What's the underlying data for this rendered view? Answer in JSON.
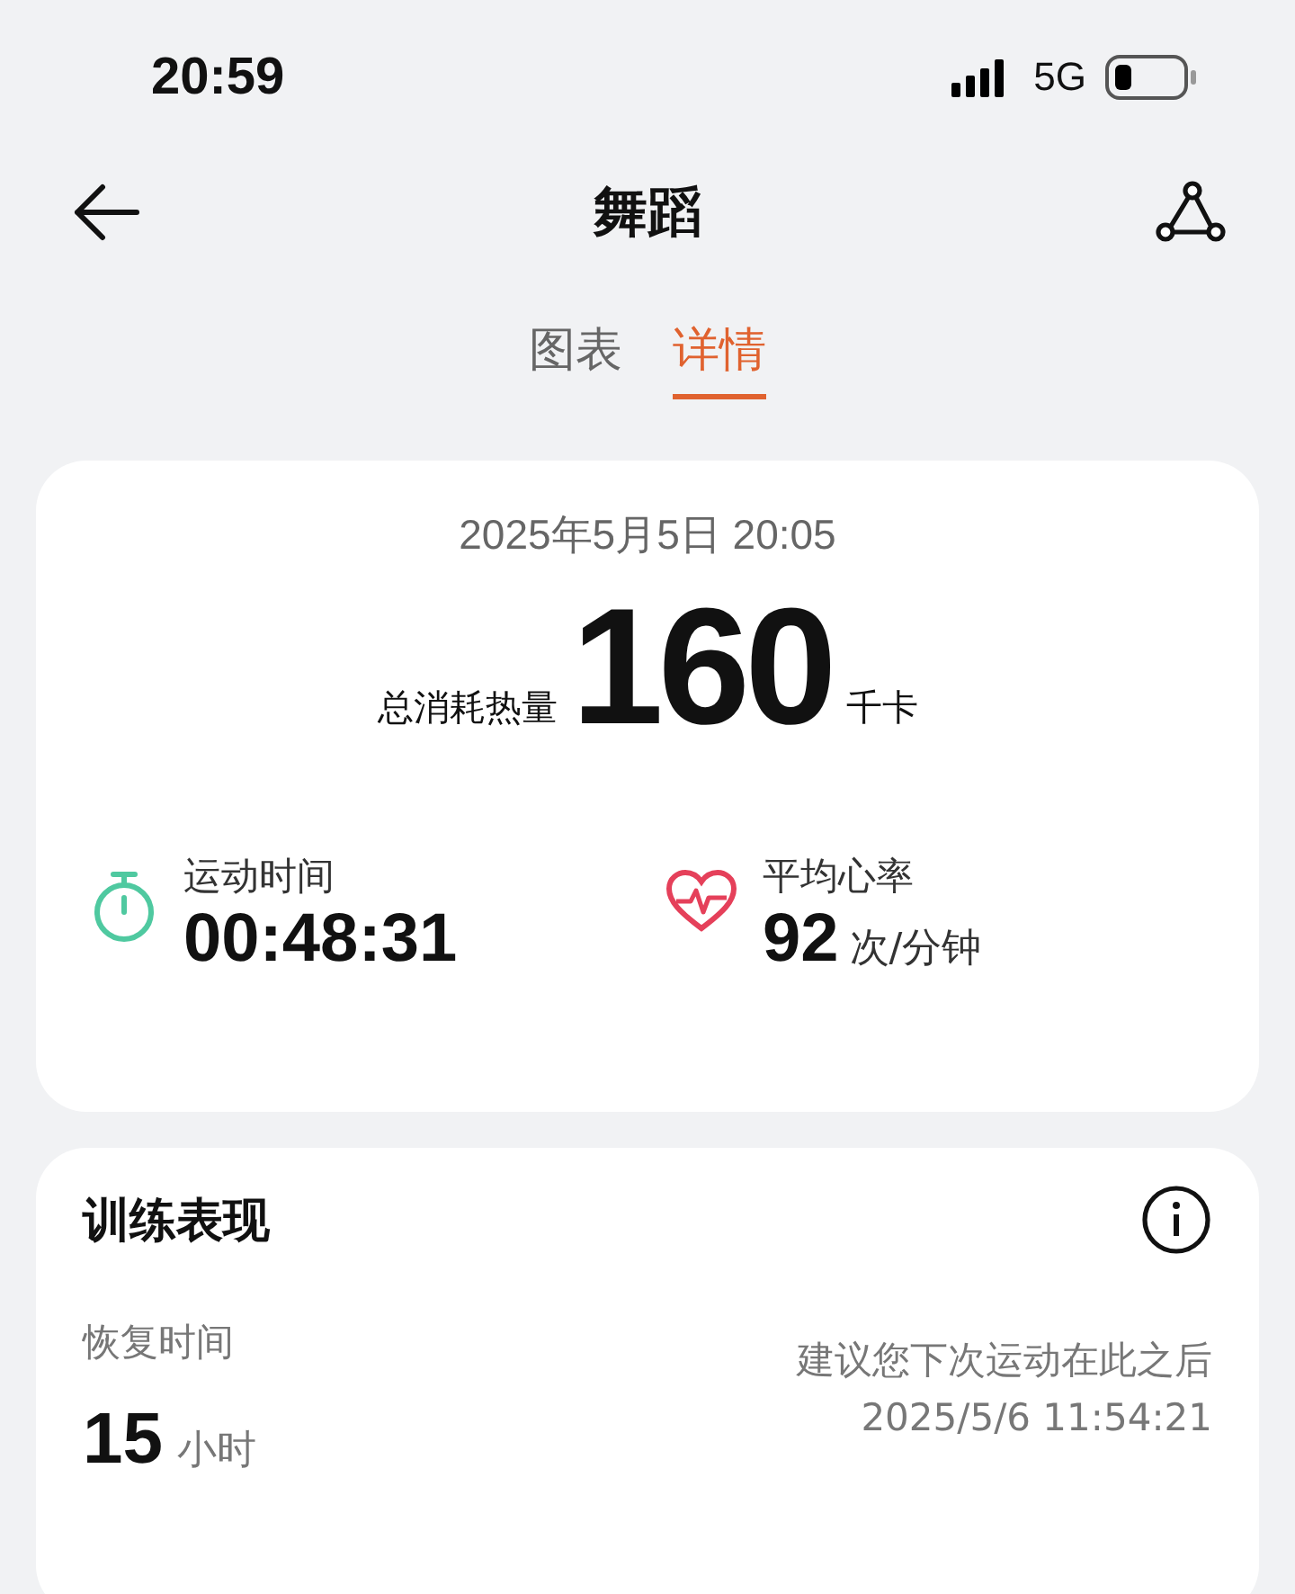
{
  "status_bar": {
    "time": "20:59",
    "network": "5G"
  },
  "header": {
    "title": "舞蹈"
  },
  "tabs": [
    {
      "label": "图表",
      "selected": false
    },
    {
      "label": "详情",
      "selected": true
    }
  ],
  "summary": {
    "datetime": "2025年5月5日 20:05",
    "calorie_label": "总消耗热量",
    "calories": "160",
    "calorie_unit": "千卡",
    "stats": [
      {
        "kind": "duration",
        "label": "运动时间",
        "value": "00:48:31"
      },
      {
        "kind": "heart_rate",
        "label": "平均心率",
        "value": "92",
        "unit": "次/分钟"
      }
    ]
  },
  "performance": {
    "title": "训练表现",
    "recovery_label": "恢复时间",
    "recovery_value": "15",
    "recovery_unit": "小时",
    "advice": "建议您下次运动在此之后",
    "advice_time": "2025/5/6 11:54:21"
  }
}
